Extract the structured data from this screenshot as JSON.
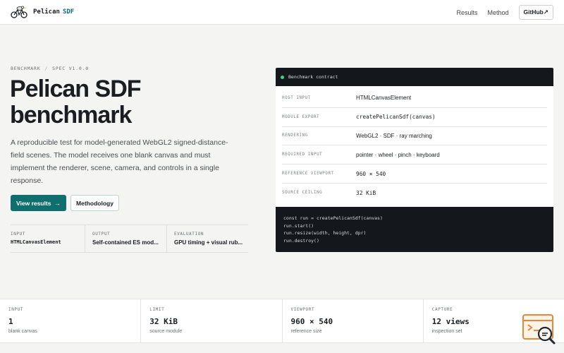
{
  "header": {
    "brand_name": "Pelican",
    "brand_accent": "SDF",
    "nav": [
      "Results",
      "Method"
    ],
    "github_label": "GitHub↗"
  },
  "hero": {
    "eyebrow_left": "BENCHMARK",
    "eyebrow_sep": "/",
    "eyebrow_right": "SPEC V1.0.0",
    "title_line1": "Pelican SDF",
    "title_line2": "benchmark",
    "lead": "A reproducible test for model-generated WebGL2 signed-distance-field scenes. The model receives one blank canvas and must implement the renderer, scene, camera, and controls in a single response.",
    "primary_button": "View results",
    "primary_arrow": "→",
    "secondary_button": "Methodology",
    "iop": [
      {
        "label": "INPUT",
        "value": "HTMLCanvasElement"
      },
      {
        "label": "OUTPUT",
        "value": "Self-contained ES mod..."
      },
      {
        "label": "EVALUATION",
        "value": "GPU timing + visual rub..."
      }
    ]
  },
  "contract": {
    "title": "Benchmark contract",
    "rows": [
      {
        "key": "HOST INPUT",
        "value": "HTMLCanvasElement"
      },
      {
        "key": "MODULE EXPORT",
        "value": "createPelicanSdf(canvas)"
      },
      {
        "key": "RENDERING",
        "value": "WebGL2 · SDF · ray marching"
      },
      {
        "key": "REQUIRED INPUT",
        "value": "pointer · wheel · pinch · keyboard"
      },
      {
        "key": "REFERENCE VIEWPORT",
        "value": "960 × 540"
      },
      {
        "key": "SOURCE CEILING",
        "value": "32 KiB"
      }
    ],
    "code": [
      "const run = createPelicanSdf(canvas)",
      "run.start()",
      "run.resize(width, height, dpr)",
      "run.destroy()"
    ]
  },
  "stats": [
    {
      "label": "INPUT",
      "value": "1",
      "sub": "blank canvas"
    },
    {
      "label": "LIMIT",
      "value": "32 KiB",
      "sub": "source module"
    },
    {
      "label": "VIEWPORT",
      "value": "960 × 540",
      "sub": "reference size"
    },
    {
      "label": "CAPTURE",
      "value": "12 views",
      "sub": "inspection set"
    }
  ],
  "colors": {
    "accent": "#0f6e6e",
    "panel": "#14181c",
    "status": "#3fcf8e"
  }
}
